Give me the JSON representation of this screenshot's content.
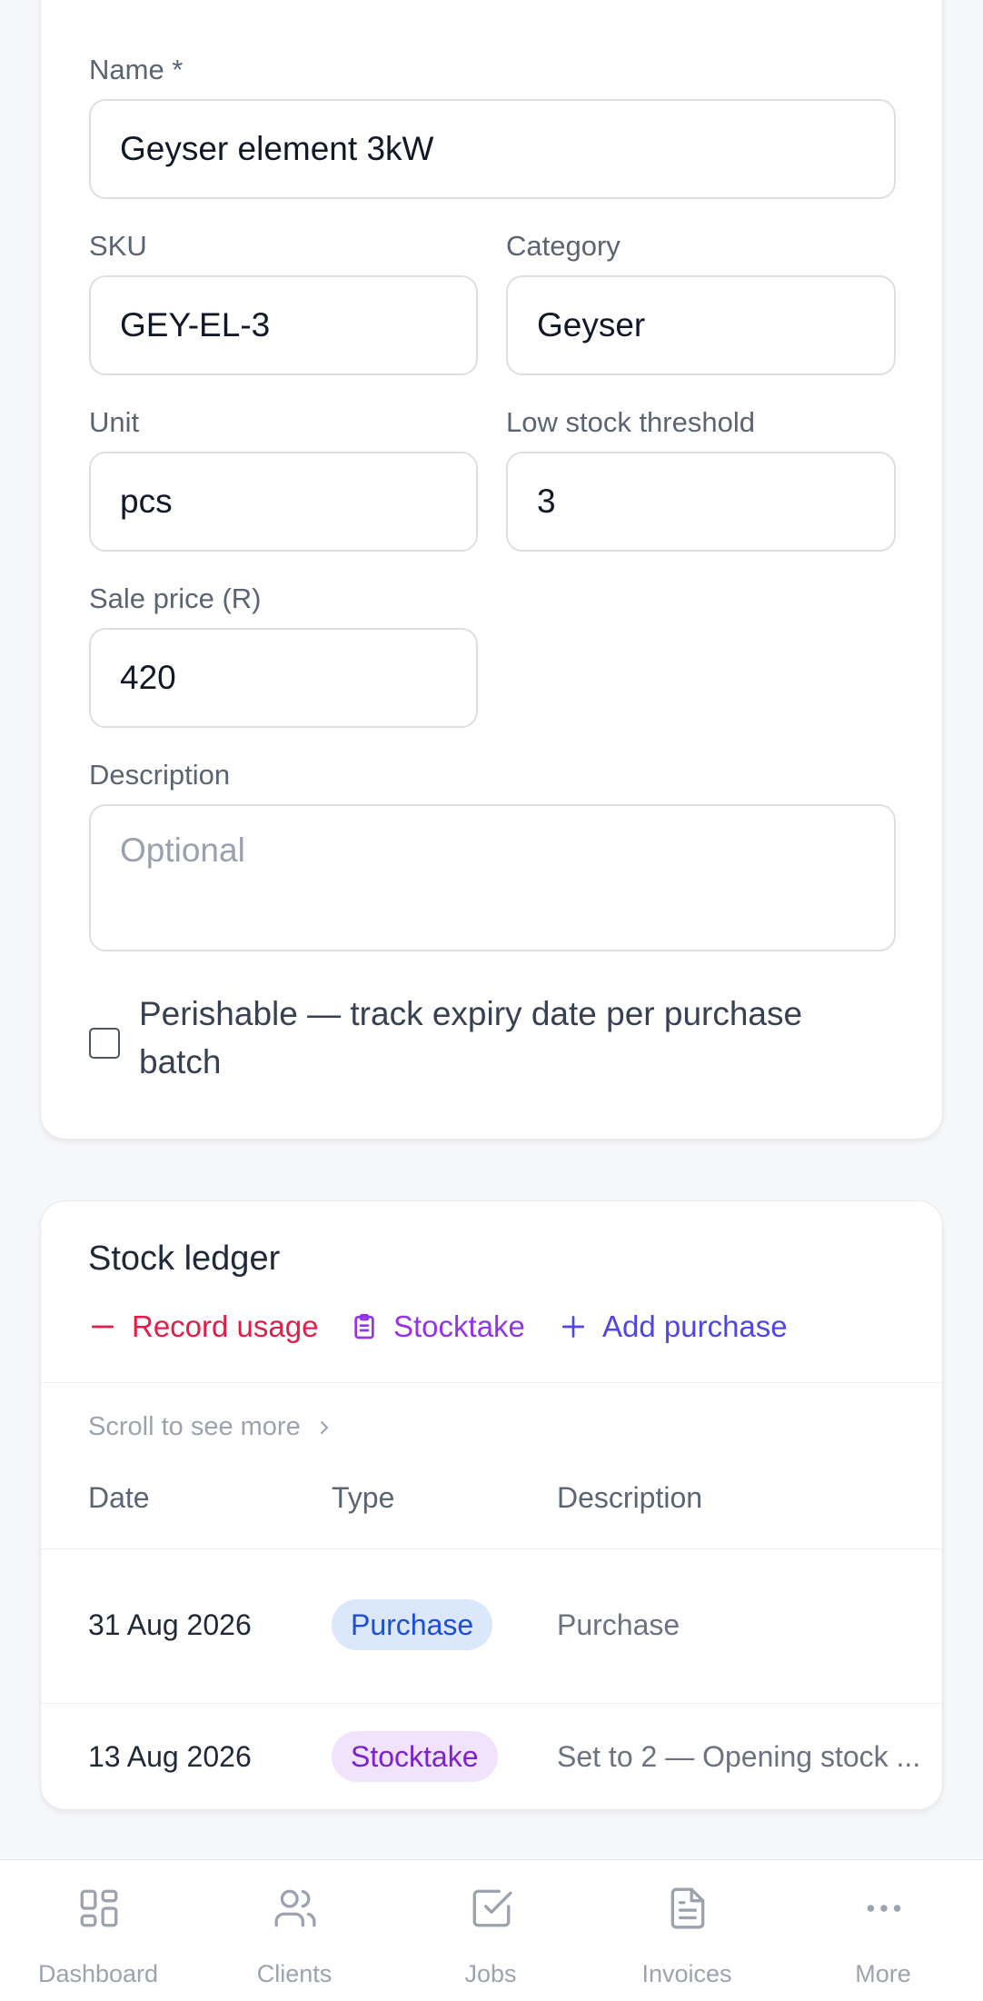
{
  "form": {
    "name": {
      "label": "Name *",
      "value": "Geyser element 3kW"
    },
    "sku": {
      "label": "SKU",
      "value": "GEY-EL-3"
    },
    "category": {
      "label": "Category",
      "value": "Geyser"
    },
    "unit": {
      "label": "Unit",
      "value": "pcs"
    },
    "low_stock": {
      "label": "Low stock threshold",
      "value": "3"
    },
    "sale_price": {
      "label": "Sale price (R)",
      "value": "420"
    },
    "description": {
      "label": "Description",
      "placeholder": "Optional",
      "value": ""
    },
    "perishable": {
      "label": "Perishable — track expiry date per purchase batch",
      "checked": false
    }
  },
  "ledger": {
    "title": "Stock ledger",
    "actions": {
      "record_usage": "Record usage",
      "stocktake": "Stocktake",
      "add_purchase": "Add purchase"
    },
    "scroll_hint": "Scroll to see more",
    "columns": {
      "date": "Date",
      "type": "Type",
      "description": "Description"
    },
    "rows": [
      {
        "date": "31 Aug 2026",
        "type": "Purchase",
        "description": "Purchase"
      },
      {
        "date": "13 Aug 2026",
        "type": "Stocktake",
        "description": "Set to 2 — Opening stock ..."
      }
    ]
  },
  "nav": {
    "dashboard": "Dashboard",
    "clients": "Clients",
    "jobs": "Jobs",
    "invoices": "Invoices",
    "more": "More"
  },
  "icons": {
    "record_usage": "minus-icon",
    "stocktake": "clipboard-icon",
    "add_purchase": "plus-icon",
    "scroll_hint": "chevron-right-icon",
    "nav_dashboard": "grid-icon",
    "nav_clients": "users-icon",
    "nav_jobs": "check-square-icon",
    "nav_invoices": "document-icon",
    "nav_more": "more-dots-icon"
  },
  "colors": {
    "danger": "#e11d48",
    "stocktake": "#9333ea",
    "primary": "#4f46e5",
    "badge_purchase_bg": "#dbe7fb",
    "badge_purchase_text": "#1d4ed8",
    "badge_stocktake_bg": "#f1e3fb",
    "badge_stocktake_text": "#7e22ce"
  }
}
